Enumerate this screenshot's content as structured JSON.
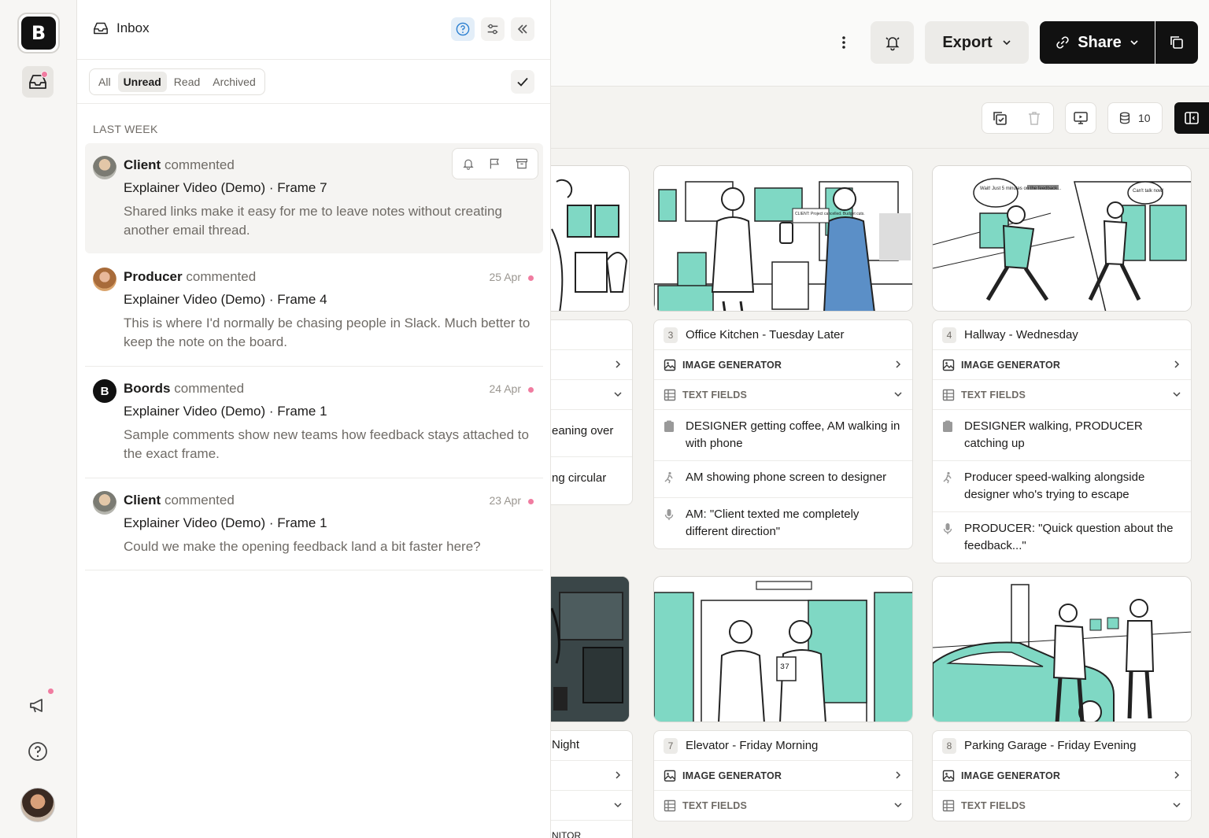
{
  "brand": {
    "logo_letter": "B"
  },
  "inbox": {
    "title": "Inbox",
    "filters": [
      "All",
      "Unread",
      "Read",
      "Archived"
    ],
    "active_filter": "Unread",
    "section": "LAST WEEK",
    "items": [
      {
        "who": "Client",
        "action": "commented",
        "subject": "Explainer Video (Demo) · Frame 7",
        "body": "Shared links make it easy for me to leave notes without creating another email thread.",
        "date": ""
      },
      {
        "who": "Producer",
        "action": "commented",
        "subject": "Explainer Video (Demo) · Frame 4",
        "body": "This is where I'd normally be chasing people in Slack. Much better to keep the note on the board.",
        "date": "25 Apr"
      },
      {
        "who": "Boords",
        "action": "commented",
        "subject": "Explainer Video (Demo) · Frame 1",
        "body": "Sample comments show new teams how feedback stays attached to the exact frame.",
        "date": "24 Apr"
      },
      {
        "who": "Client",
        "action": "commented",
        "subject": "Explainer Video (Demo) · Frame 1",
        "body": "Could we make the opening feedback land a bit faster here?",
        "date": "23 Apr"
      }
    ]
  },
  "topbar": {
    "export_label": "Export",
    "share_label": "Share"
  },
  "toolbar": {
    "count": "10"
  },
  "cards": [
    {
      "num": "3",
      "title": "Office Kitchen - Tuesday Later",
      "image_generator": "IMAGE GENERATOR",
      "text_fields": "TEXT FIELDS",
      "fields": [
        "DESIGNER getting coffee, AM walking in with phone",
        "AM showing phone screen to designer",
        "AM: \"Client texted me completely different direction\""
      ]
    },
    {
      "num": "4",
      "title": "Hallway - Wednesday",
      "image_generator": "IMAGE GENERATOR",
      "text_fields": "TEXT FIELDS",
      "fields": [
        "DESIGNER walking, PRODUCER catching up",
        "Producer speed-walking alongside designer who's trying to escape",
        "PRODUCER: \"Quick question about the feedback...\""
      ]
    },
    {
      "num": "7",
      "title": "Elevator - Friday Morning",
      "image_generator": "IMAGE GENERATOR",
      "text_fields": "TEXT FIELDS"
    },
    {
      "num": "8",
      "title": "Parking Garage - Friday Evening",
      "image_generator": "IMAGE GENERATOR",
      "text_fields": "TEXT FIELDS"
    }
  ],
  "partial_card": {
    "line1": "eaning over",
    "line2": "ng circular",
    "title2": "Night",
    "label": "NITOR"
  },
  "speech": {
    "bubble1": "Wait! Just 5 minutes on the feedback...",
    "bubble2": "Can't talk now!",
    "phone_screen": "CLIENT: Project cancelled. Budget cuts.",
    "elevator_display": "37"
  },
  "colors": {
    "accent_teal": "#7fd8c4",
    "unread_dot": "#f07ca0",
    "dark": "#111111"
  }
}
